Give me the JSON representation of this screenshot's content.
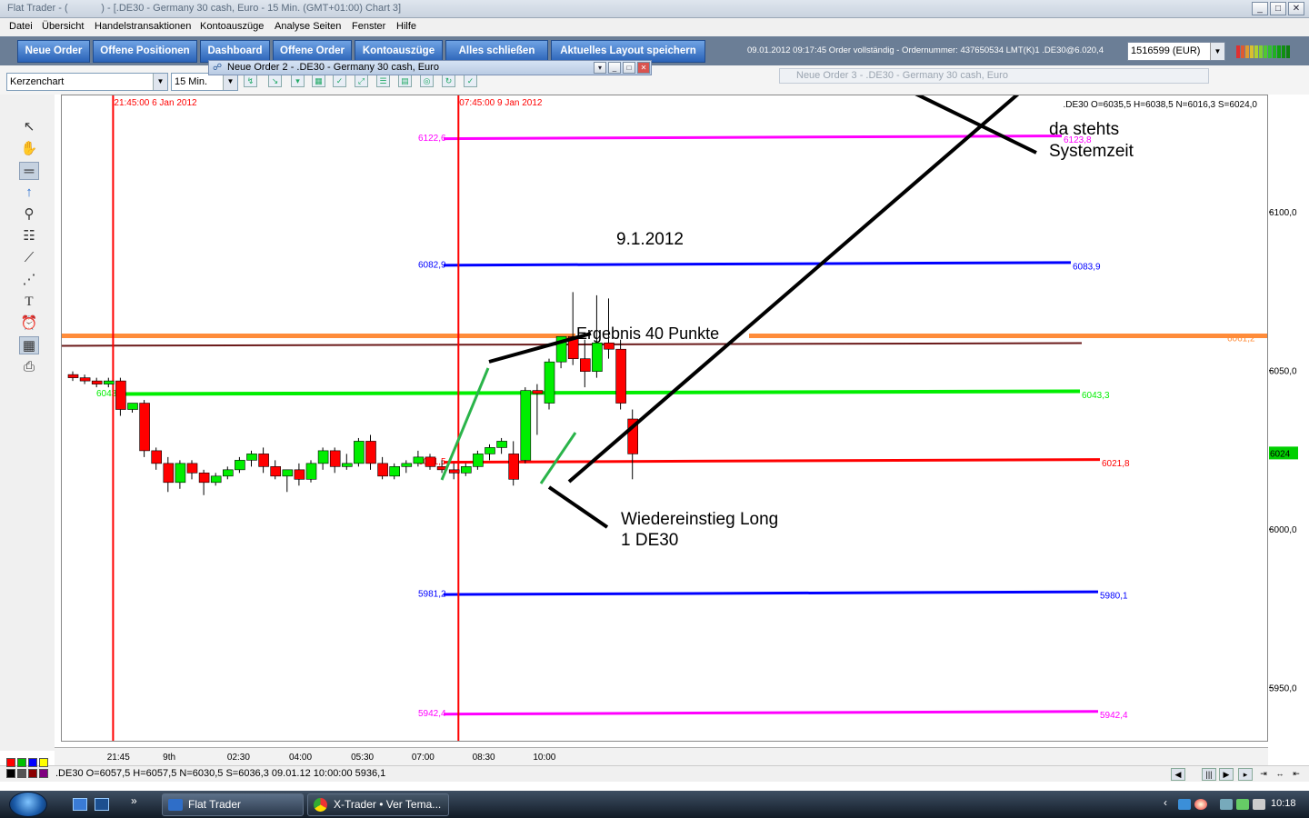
{
  "window": {
    "title": "Flat Trader - (            ) - [.DE30 - Germany 30 cash, Euro - 15 Min. (GMT+01:00)   Chart 3]",
    "min": "_",
    "max": "□",
    "close": "✕"
  },
  "menu": [
    "Datei",
    "Übersicht",
    "Handelstransaktionen",
    "Kontoauszüge",
    "Analyse Seiten",
    "Fenster",
    "Hilfe"
  ],
  "toolbar": {
    "buttons": [
      "Neue Order",
      "Offene Positionen",
      "Dashboard",
      "Offene Order",
      "Kontoauszüge",
      "Alles schließen",
      "Aktuelles Layout speichern"
    ],
    "status_text": "09.01.2012 09:17:45 Order vollständig - Ordernummer: 437650534 LMT(K)1 .DE30@6.020,4",
    "account": "1516599 (EUR)"
  },
  "chart_controls": {
    "chart_type": "Kerzenchart",
    "timeframe": "15 Min."
  },
  "popup": {
    "title": "Neue Order 2 - .DE30 - Germany 30 cash, Euro"
  },
  "bg_window": {
    "title": "Neue Order 3 - .DE30 - Germany 30 cash, Euro"
  },
  "chart_ohlc": ".DE30 O=6035,5 H=6038,5 N=6016,3 S=6024,0",
  "chart_data": {
    "type": "candlestick",
    "symbol": ".DE30",
    "timeframe": "15 Min.",
    "ylim": [
      5933,
      6137
    ],
    "y_ticks": [
      {
        "value": 6100,
        "label": "6100,0"
      },
      {
        "value": 6050,
        "label": "6050,0"
      },
      {
        "value": 6000,
        "label": "6000,0"
      },
      {
        "value": 5950,
        "label": "5950,0"
      }
    ],
    "current_price": {
      "value": 6024,
      "label": "6024"
    },
    "x_labels": [
      {
        "pos": 0.047,
        "label": "21:45"
      },
      {
        "pos": 0.093,
        "label": "9th"
      },
      {
        "pos": 0.146,
        "label": "02:30"
      },
      {
        "pos": 0.197,
        "label": "04:00"
      },
      {
        "pos": 0.248,
        "label": "05:30"
      },
      {
        "pos": 0.298,
        "label": "07:00"
      },
      {
        "pos": 0.348,
        "label": "08:30"
      },
      {
        "pos": 0.398,
        "label": "10:00"
      }
    ],
    "vertical_markers": [
      {
        "label": "21:45:00 6 Jan 2012",
        "bar": 4
      },
      {
        "label": "07:45:00 9 Jan 2012",
        "bar": 33
      }
    ],
    "candles": [
      {
        "o": 6049,
        "h": 6050,
        "c": 6048,
        "l": 6047
      },
      {
        "o": 6048,
        "h": 6049,
        "c": 6047,
        "l": 6046
      },
      {
        "o": 6047,
        "h": 6048,
        "c": 6046,
        "l": 6045
      },
      {
        "o": 6046,
        "h": 6048,
        "c": 6047,
        "l": 6045
      },
      {
        "o": 6047,
        "h": 6048,
        "c": 6038,
        "l": 6036
      },
      {
        "o": 6038,
        "h": 6040,
        "c": 6040,
        "l": 6037
      },
      {
        "o": 6040,
        "h": 6041,
        "c": 6025,
        "l": 6023
      },
      {
        "o": 6025,
        "h": 6026,
        "c": 6021,
        "l": 6019
      },
      {
        "o": 6021,
        "h": 6023,
        "c": 6015,
        "l": 6012
      },
      {
        "o": 6015,
        "h": 6022,
        "c": 6021,
        "l": 6013
      },
      {
        "o": 6021,
        "h": 6022,
        "c": 6018,
        "l": 6016
      },
      {
        "o": 6018,
        "h": 6019,
        "c": 6015,
        "l": 6011
      },
      {
        "o": 6015,
        "h": 6018,
        "c": 6017,
        "l": 6014
      },
      {
        "o": 6017,
        "h": 6020,
        "c": 6019,
        "l": 6016
      },
      {
        "o": 6019,
        "h": 6023,
        "c": 6022,
        "l": 6018
      },
      {
        "o": 6022,
        "h": 6025,
        "c": 6024,
        "l": 6020
      },
      {
        "o": 6024,
        "h": 6026,
        "c": 6020,
        "l": 6018
      },
      {
        "o": 6020,
        "h": 6022,
        "c": 6017,
        "l": 6016
      },
      {
        "o": 6017,
        "h": 6019,
        "c": 6019,
        "l": 6012
      },
      {
        "o": 6019,
        "h": 6021,
        "c": 6016,
        "l": 6014
      },
      {
        "o": 6016,
        "h": 6022,
        "c": 6021,
        "l": 6015
      },
      {
        "o": 6021,
        "h": 6026,
        "c": 6025,
        "l": 6019
      },
      {
        "o": 6025,
        "h": 6026,
        "c": 6020,
        "l": 6018
      },
      {
        "o": 6020,
        "h": 6024,
        "c": 6021,
        "l": 6019
      },
      {
        "o": 6021,
        "h": 6029,
        "c": 6028,
        "l": 6020
      },
      {
        "o": 6028,
        "h": 6030,
        "c": 6021,
        "l": 6019
      },
      {
        "o": 6021,
        "h": 6023,
        "c": 6017,
        "l": 6016
      },
      {
        "o": 6017,
        "h": 6021,
        "c": 6020,
        "l": 6016
      },
      {
        "o": 6020,
        "h": 6022,
        "c": 6021,
        "l": 6018
      },
      {
        "o": 6021,
        "h": 6025,
        "c": 6023,
        "l": 6020
      },
      {
        "o": 6023,
        "h": 6024,
        "c": 6020,
        "l": 6019
      },
      {
        "o": 6020,
        "h": 6022,
        "c": 6019,
        "l": 6018
      },
      {
        "o": 6019,
        "h": 6021,
        "c": 6018,
        "l": 6016
      },
      {
        "o": 6018,
        "h": 6021,
        "c": 6020,
        "l": 6017
      },
      {
        "o": 6020,
        "h": 6025,
        "c": 6024,
        "l": 6019
      },
      {
        "o": 6024,
        "h": 6027,
        "c": 6026,
        "l": 6022
      },
      {
        "o": 6026,
        "h": 6029,
        "c": 6028,
        "l": 6024
      },
      {
        "o": 6024,
        "h": 6028,
        "c": 6016,
        "l": 6014
      },
      {
        "o": 6022,
        "h": 6045,
        "c": 6044,
        "l": 6021
      },
      {
        "o": 6044,
        "h": 6046,
        "c": 6043,
        "l": 6030
      },
      {
        "o": 6040,
        "h": 6054,
        "c": 6053,
        "l": 6038
      },
      {
        "o": 6053,
        "h": 6061,
        "c": 6061,
        "l": 6051
      },
      {
        "o": 6061,
        "h": 6075,
        "c": 6054,
        "l": 6052
      },
      {
        "o": 6054,
        "h": 6060,
        "c": 6050,
        "l": 6045
      },
      {
        "o": 6050,
        "h": 6074,
        "c": 6059,
        "l": 6048
      },
      {
        "o": 6059,
        "h": 6073,
        "c": 6057,
        "l": 6054
      },
      {
        "o": 6057,
        "h": 6060,
        "c": 6040,
        "l": 6038
      },
      {
        "o": 6035,
        "h": 6038,
        "c": 6024,
        "l": 6016
      }
    ],
    "levels": [
      {
        "name": "magenta-top",
        "value": 6123.8,
        "left_label": "6122,6",
        "right_label": "6123,8",
        "color": "#ff00ff"
      },
      {
        "name": "blue-top",
        "value": 6083.9,
        "left_label": "6082,9",
        "right_label": "6083,9",
        "color": "#0000ff"
      },
      {
        "name": "orange",
        "value": 6061.2,
        "left_label": "",
        "right_label": "6061,2",
        "color": "#ff8c3a"
      },
      {
        "name": "brown",
        "value": 6058.5,
        "left_label": "",
        "right_label": "",
        "color": "#6b1a1a"
      },
      {
        "name": "green",
        "value": 6043.3,
        "left_label": "6043,3",
        "right_label": "6043,3",
        "color": "#00ee00"
      },
      {
        "name": "red",
        "value": 6021.8,
        "left_label": "6021,5",
        "right_label": "6021,8",
        "color": "#ff0000"
      },
      {
        "name": "blue-bottom",
        "value": 5980.1,
        "left_label": "5981,2",
        "right_label": "5980,1",
        "color": "#0000ff"
      },
      {
        "name": "magenta-bottom",
        "value": 5942.4,
        "left_label": "5942,4",
        "right_label": "5942,4",
        "color": "#ff00ff"
      }
    ],
    "annotations": {
      "date": "9.1.2012",
      "result": "Ergebnis 40 Punkte",
      "reentry_line1": "Wiedereinstieg Long",
      "reentry_line2": "1 DE30",
      "systime_line1": "da stehts",
      "systime_line2": "Systemzeit"
    }
  },
  "bottom_ohlc": ".DE30 O=6057,5 H=6057,5 N=6030,5 S=6036,3   09.01.12 10:00:00 5936,1",
  "taskbar": {
    "items": [
      "Flat Trader",
      "X-Trader • Ver Tema..."
    ],
    "clock": "10:18"
  },
  "colors": {
    "bull": "#00ee00",
    "bear": "#ff0000",
    "toolbar_button": "#2a63b8",
    "toolbar_bg": "#6b7e96"
  }
}
